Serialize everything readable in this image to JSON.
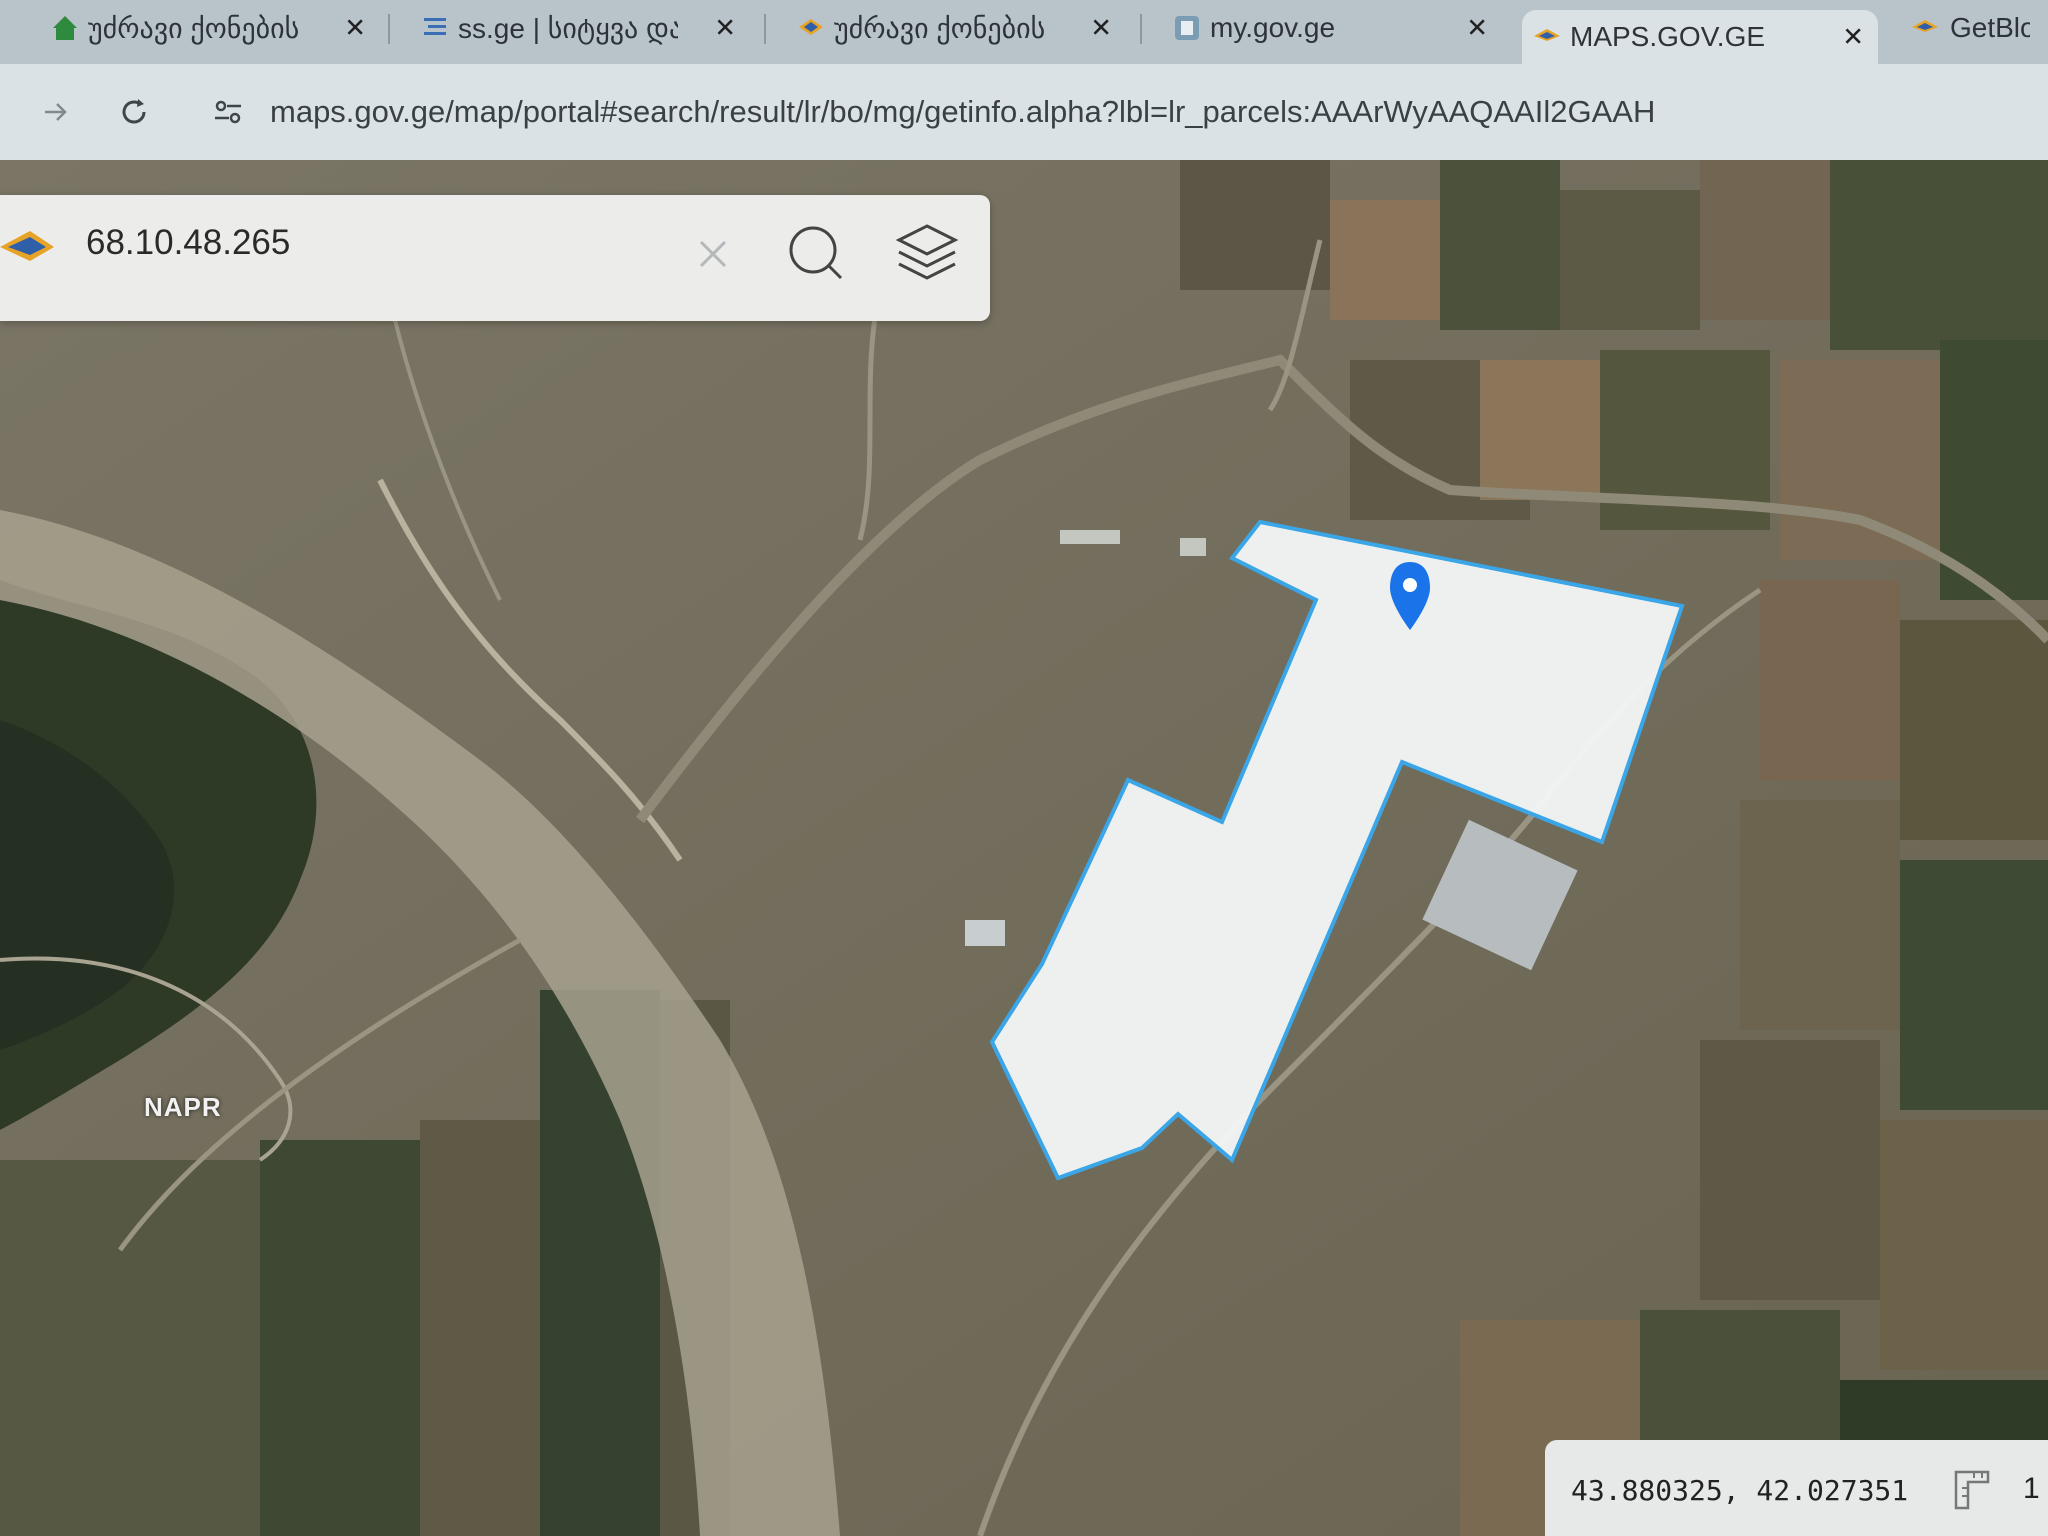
{
  "browser": {
    "tabs": [
      {
        "label": "უძრავი ქონების",
        "icon": "house-icon"
      },
      {
        "label": "ss.ge | სიტყვა და",
        "icon": "ss-logo-icon"
      },
      {
        "label": "უძრავი ქონების",
        "icon": "napr-logo-icon"
      },
      {
        "label": "my.gov.ge",
        "icon": "mygov-logo-icon"
      },
      {
        "label": "MAPS.GOV.GE",
        "icon": "maps-logo-icon",
        "active": true
      },
      {
        "label": "GetBlob",
        "icon": "maps-logo-icon"
      }
    ],
    "close_glyph": "✕",
    "url": "maps.gov.ge/map/portal#search/result/lr/bo/mg/getinfo.alpha?lbl=lr_parcels:AAArWyAAQAAIl2GAAH"
  },
  "search": {
    "value": "68.10.48.265"
  },
  "map": {
    "label": "NAPR",
    "parcel_fill": "#f4f6f6",
    "parcel_outline": "#3aa6e8",
    "marker_color": "#1a73e8"
  },
  "status": {
    "coordinates": "43.880325, 42.027351",
    "scale": "1"
  }
}
